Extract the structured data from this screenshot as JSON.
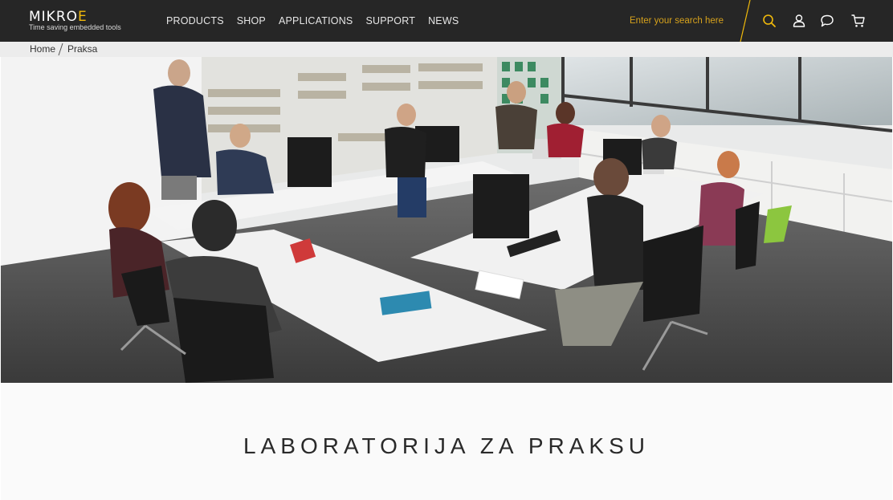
{
  "header": {
    "logo_text_main": "MIKRO",
    "logo_text_accent": "E",
    "logo_tagline": "Time saving embedded tools",
    "nav": [
      "PRODUCTS",
      "SHOP",
      "APPLICATIONS",
      "SUPPORT",
      "NEWS"
    ],
    "search_placeholder": "Enter your search here",
    "icons": [
      "search-icon",
      "user-icon",
      "chat-icon",
      "cart-icon"
    ],
    "accent_color": "#f0b90b",
    "bar_color": "#262626"
  },
  "breadcrumb": [
    "Home",
    "Praksa"
  ],
  "hero": {
    "alt": "Students working with embedded hardware at desks in the MikroElektronika practice lab"
  },
  "main": {
    "title": "LABORATORIJA ZA PRAKSU"
  }
}
